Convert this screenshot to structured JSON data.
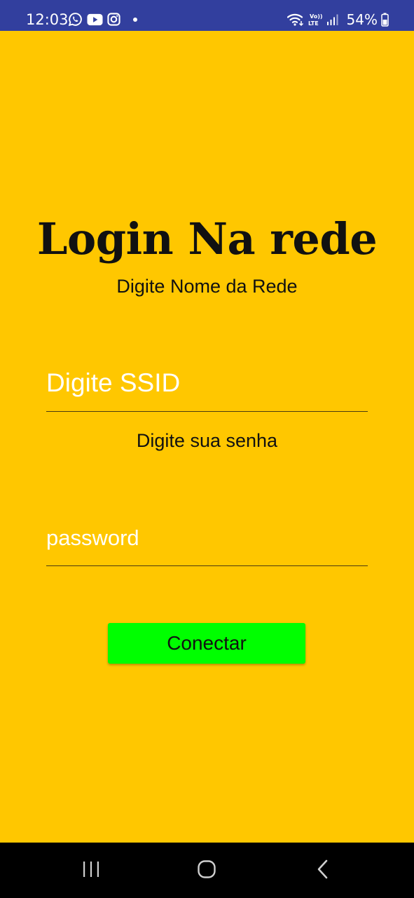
{
  "status_bar": {
    "time": "12:03",
    "battery": "54%",
    "left_icons": [
      "whatsapp-icon",
      "youtube-icon",
      "instagram-icon",
      "notification-dot"
    ],
    "right_icons": [
      "wifi-icon",
      "volte-icon",
      "signal-icon",
      "battery-icon"
    ],
    "volte_label_top": "Vo))",
    "volte_label_bottom": "LTE",
    "background": "#323F9E"
  },
  "login": {
    "title": "Login Na rede",
    "subtitle": "Digite Nome da Rede",
    "ssid_placeholder": "Digite SSID",
    "ssid_value": "",
    "password_label": "Digite sua senha",
    "password_placeholder": "password",
    "password_value": "",
    "connect_label": "Conectar",
    "background": "#FFC700",
    "button_color": "#00FF00"
  },
  "nav_bar": {
    "buttons": [
      "recents-icon",
      "home-icon",
      "back-icon"
    ]
  }
}
